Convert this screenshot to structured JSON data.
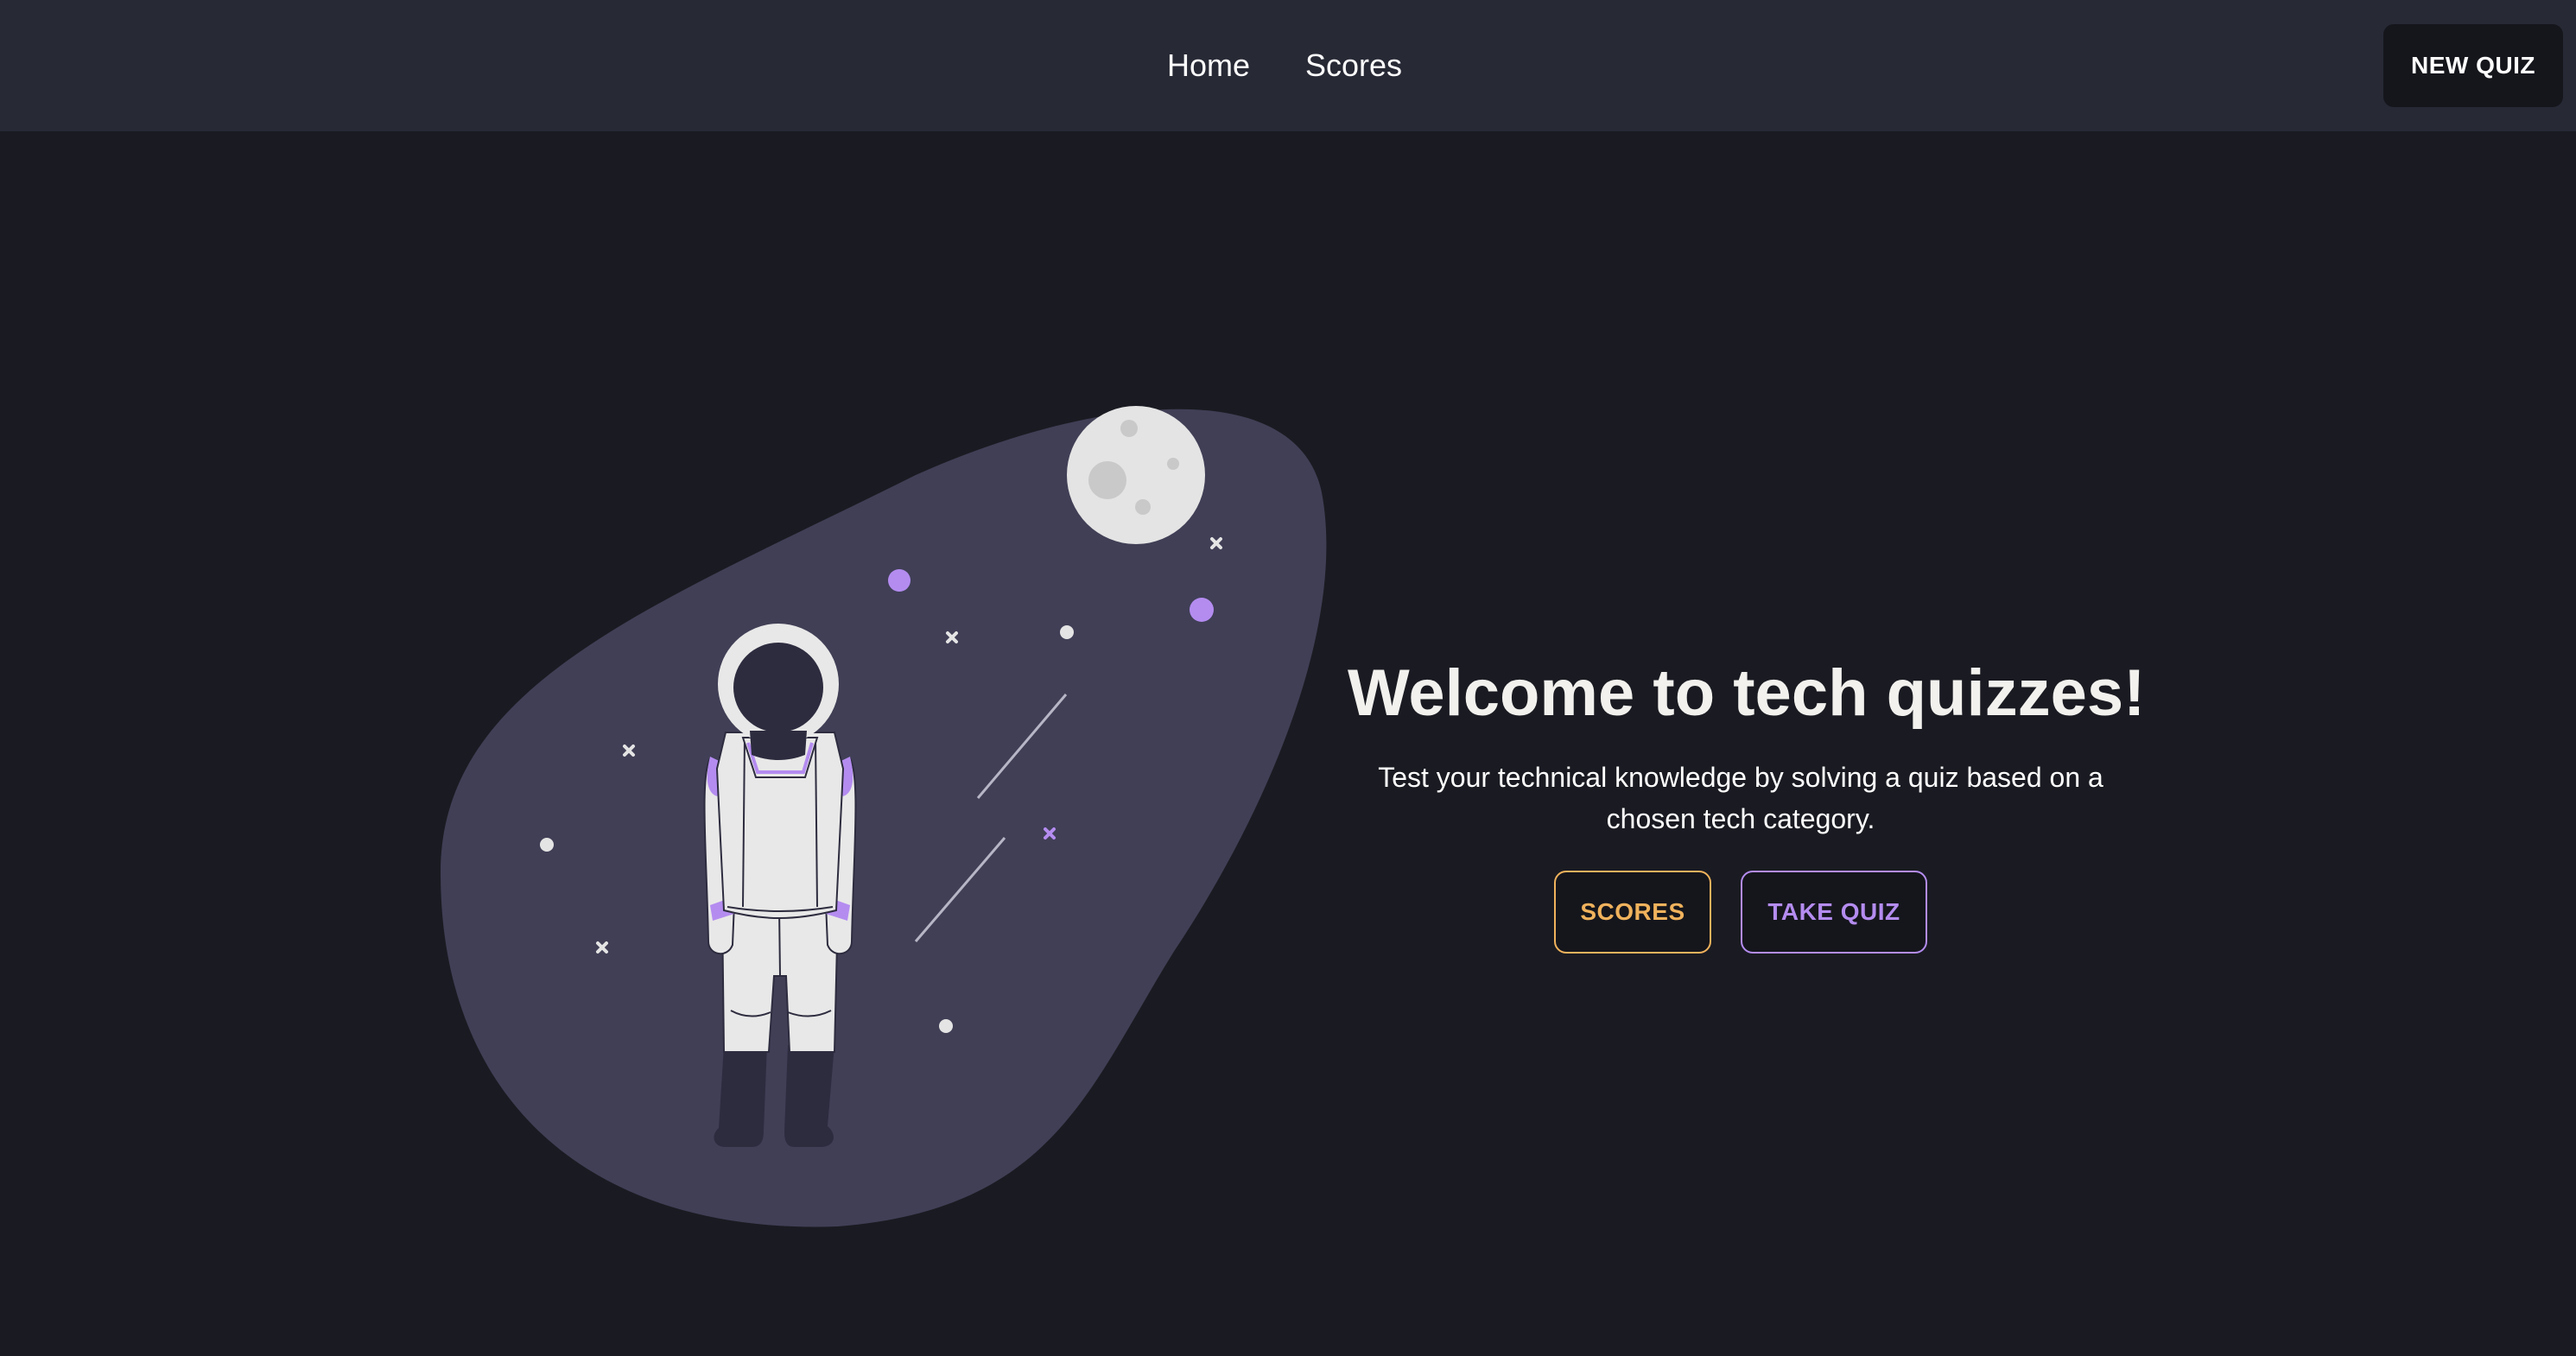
{
  "header": {
    "nav": [
      {
        "label": "Home"
      },
      {
        "label": "Scores"
      }
    ],
    "new_quiz_label": "NEW QUIZ"
  },
  "hero": {
    "title": "Welcome to tech quizzes!",
    "subtitle": "Test your technical knowledge by solving a quiz based on a chosen tech category.",
    "scores_label": "SCORES",
    "take_quiz_label": "TAKE QUIZ"
  },
  "colors": {
    "background": "#1a1b22",
    "topbar": "#272935",
    "blob": "#403f56",
    "accent_orange": "#f0b25c",
    "accent_purple": "#b48cf0"
  },
  "illustration": {
    "icons": [
      "astronaut-illustration",
      "moon-icon",
      "star-icon",
      "planet-dot-icon",
      "shooting-star-icon"
    ]
  }
}
